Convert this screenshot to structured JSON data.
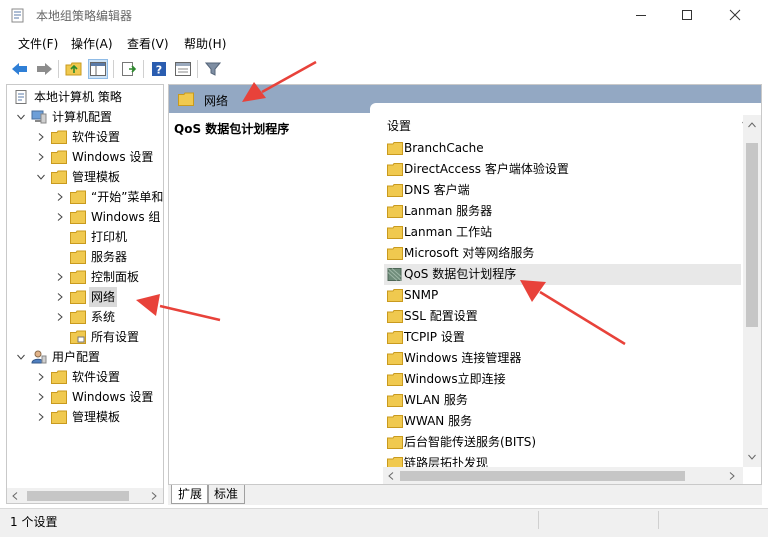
{
  "window": {
    "title": "本地组策略编辑器"
  },
  "menu": [
    {
      "label": "文件(F)"
    },
    {
      "label": "操作(A)"
    },
    {
      "label": "查看(V)"
    },
    {
      "label": "帮助(H)"
    }
  ],
  "tree": {
    "items": [
      {
        "label": "本地计算机 策略"
      },
      {
        "label": "计算机配置"
      },
      {
        "label": "软件设置"
      },
      {
        "label": "Windows 设置"
      },
      {
        "label": "管理模板"
      },
      {
        "label": "“开始”菜单和"
      },
      {
        "label": "Windows 组"
      },
      {
        "label": "打印机"
      },
      {
        "label": "服务器"
      },
      {
        "label": "控制面板"
      },
      {
        "label": "网络"
      },
      {
        "label": "系统"
      },
      {
        "label": "所有设置"
      },
      {
        "label": "用户配置"
      },
      {
        "label": "软件设置"
      },
      {
        "label": "Windows 设置"
      },
      {
        "label": "管理模板"
      }
    ]
  },
  "pane": {
    "header": "网络",
    "description": "QoS 数据包计划程序",
    "list_header": "设置",
    "items": [
      {
        "label": "BranchCache"
      },
      {
        "label": "DirectAccess 客户端体验设置"
      },
      {
        "label": "DNS 客户端"
      },
      {
        "label": "Lanman 服务器"
      },
      {
        "label": "Lanman 工作站"
      },
      {
        "label": "Microsoft 对等网络服务"
      },
      {
        "label": "QoS 数据包计划程序"
      },
      {
        "label": "SNMP"
      },
      {
        "label": "SSL 配置设置"
      },
      {
        "label": "TCPIP 设置"
      },
      {
        "label": "Windows 连接管理器"
      },
      {
        "label": "Windows立即连接"
      },
      {
        "label": "WLAN 服务"
      },
      {
        "label": "WWAN 服务"
      },
      {
        "label": "后台智能传送服务(BITS)"
      },
      {
        "label": "链路层拓扑发现"
      }
    ],
    "tabs": [
      {
        "label": "扩展"
      },
      {
        "label": "标准"
      }
    ]
  },
  "status": {
    "text": "1 个设置"
  },
  "colors": {
    "header_bg": "#93a8c3",
    "folder": "#f0c94f",
    "arrow": "#e8423a"
  }
}
